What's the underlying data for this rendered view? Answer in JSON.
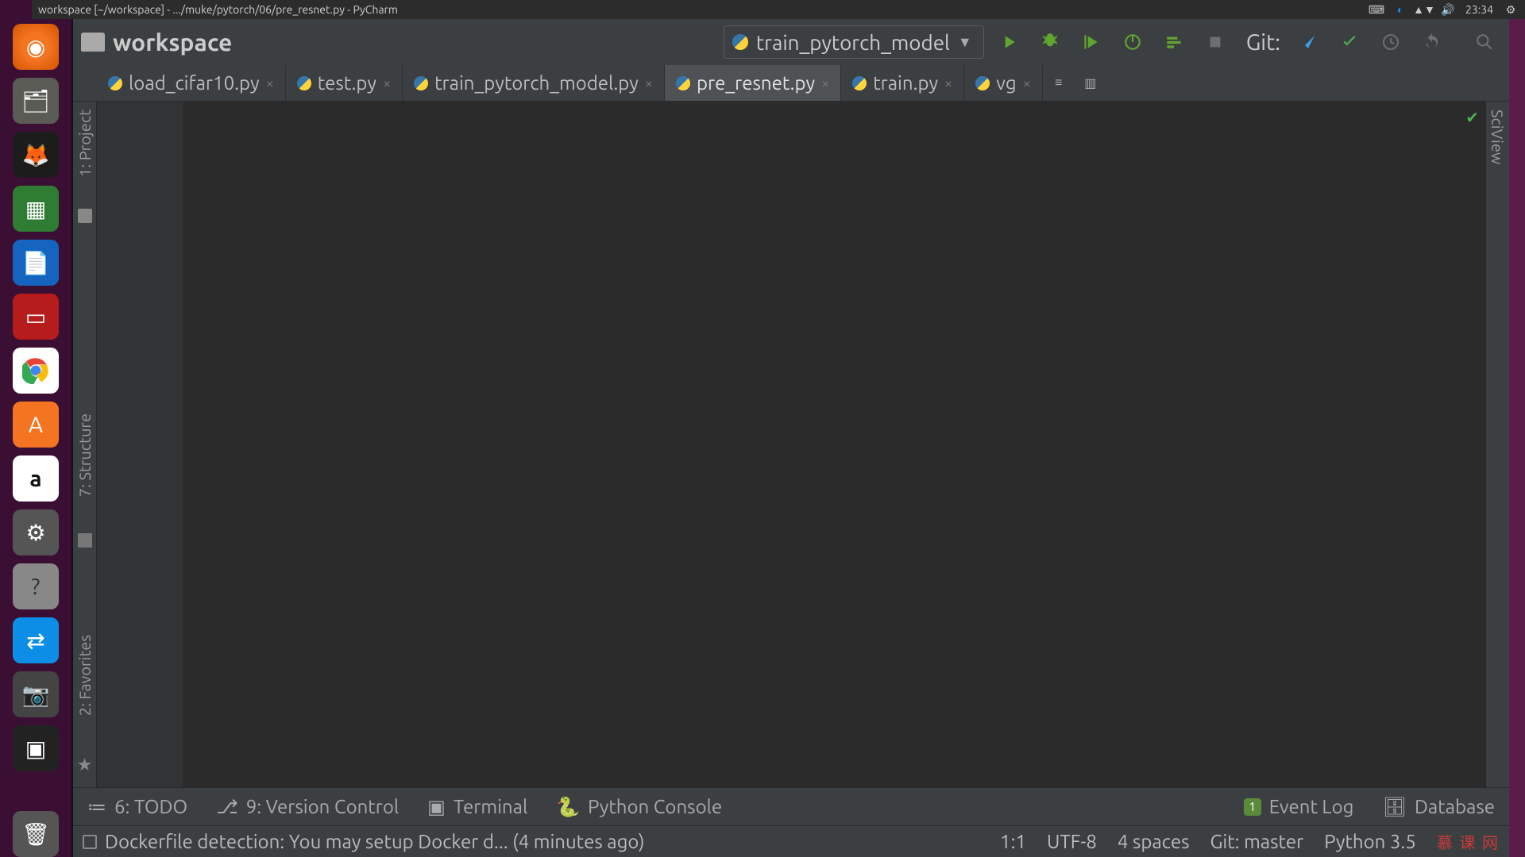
{
  "window_title": "workspace [~/workspace] - .../muke/pytorch/06/pre_resnet.py - PyCharm",
  "tray": {
    "time": "23:34"
  },
  "project": {
    "name": "workspace"
  },
  "run_config": {
    "label": "train_pytorch_model"
  },
  "git": {
    "label": "Git:"
  },
  "tabs": [
    {
      "label": "load_cifar10.py"
    },
    {
      "label": "test.py"
    },
    {
      "label": "train_pytorch_model.py"
    },
    {
      "label": "pre_resnet.py"
    },
    {
      "label": "train.py"
    },
    {
      "label": "vg"
    }
  ],
  "left_tools": {
    "project": "1: Project",
    "structure": "7: Structure",
    "favorites": "2: Favorites"
  },
  "right_tools": {
    "sciview": "SciView"
  },
  "bottom_tools": {
    "todo": "6: TODO",
    "vcs": "9: Version Control",
    "terminal": "Terminal",
    "pyconsole": "Python Console",
    "eventlog_badge": "1",
    "eventlog": "Event Log",
    "database": "Database"
  },
  "status": {
    "message": "Dockerfile detection: You may setup Docker d... (4 minutes ago)",
    "caret": "1:1",
    "encoding": "UTF-8",
    "indent": "4 spaces",
    "branch": "Git: master",
    "python": "Python 3.5",
    "watermark": "慕 课 网"
  }
}
